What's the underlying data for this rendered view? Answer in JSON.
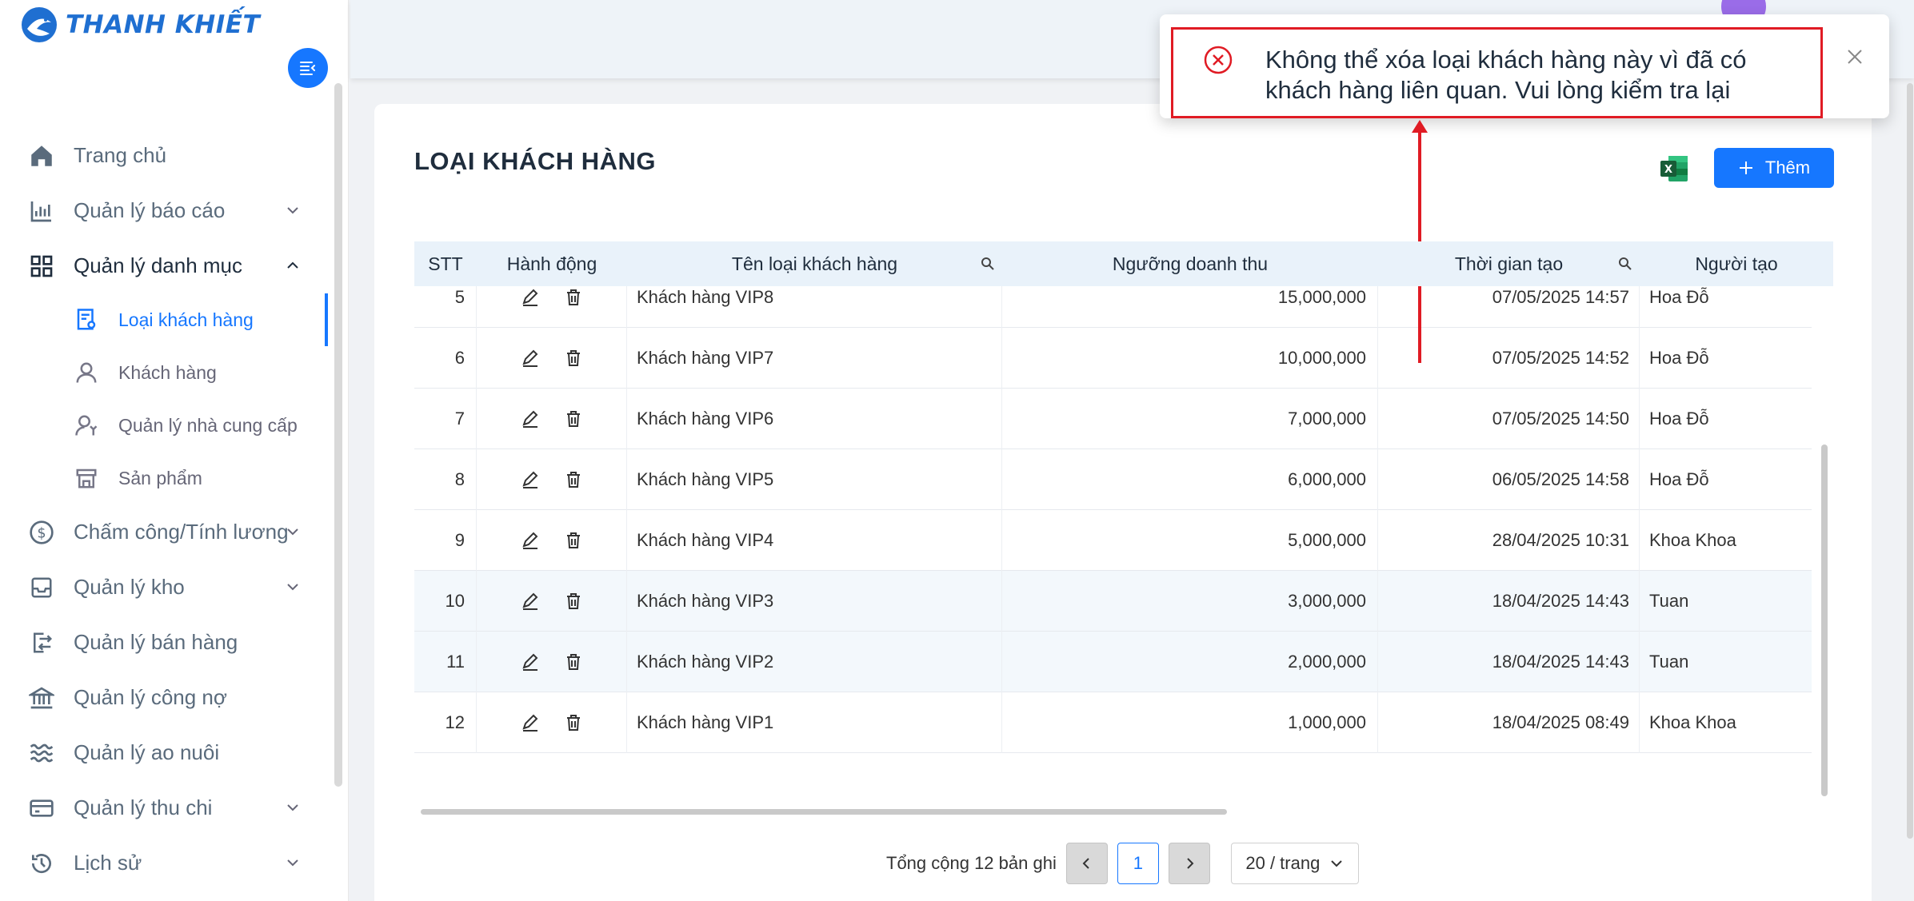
{
  "brand": {
    "name": "THANH KHIẾT"
  },
  "sidebar": {
    "items": [
      {
        "label": "Trang chủ"
      },
      {
        "label": "Quản lý báo cáo"
      },
      {
        "label": "Quản lý danh mục"
      },
      {
        "label": "Chấm công/Tính lương"
      },
      {
        "label": "Quản lý kho"
      },
      {
        "label": "Quản lý bán hàng"
      },
      {
        "label": "Quản lý công nợ"
      },
      {
        "label": "Quản lý ao nuôi"
      },
      {
        "label": "Quản lý thu chi"
      },
      {
        "label": "Lịch sử"
      }
    ],
    "sub_items": [
      {
        "label": "Loại khách hàng"
      },
      {
        "label": "Khách hàng"
      },
      {
        "label": "Quản lý nhà cung cấp"
      },
      {
        "label": "Sản phẩm"
      }
    ]
  },
  "page": {
    "title": "LOẠI KHÁCH HÀNG",
    "add_label": "Thêm"
  },
  "table": {
    "columns": [
      "STT",
      "Hành động",
      "Tên loại khách hàng",
      "Ngưỡng doanh thu",
      "Thời gian tạo",
      "Người tạo"
    ],
    "rows": [
      {
        "stt": "5",
        "name": "Khách hàng VIP8",
        "threshold": "15,000,000",
        "created": "07/05/2025 14:57",
        "creator": "Hoa Đỗ"
      },
      {
        "stt": "6",
        "name": "Khách hàng VIP7",
        "threshold": "10,000,000",
        "created": "07/05/2025 14:52",
        "creator": "Hoa Đỗ"
      },
      {
        "stt": "7",
        "name": "Khách hàng VIP6",
        "threshold": "7,000,000",
        "created": "07/05/2025 14:50",
        "creator": "Hoa Đỗ"
      },
      {
        "stt": "8",
        "name": "Khách hàng VIP5",
        "threshold": "6,000,000",
        "created": "06/05/2025 14:58",
        "creator": "Hoa Đỗ"
      },
      {
        "stt": "9",
        "name": "Khách hàng VIP4",
        "threshold": "5,000,000",
        "created": "28/04/2025 10:31",
        "creator": "Khoa Khoa"
      },
      {
        "stt": "10",
        "name": "Khách hàng VIP3",
        "threshold": "3,000,000",
        "created": "18/04/2025 14:43",
        "creator": "Tuan"
      },
      {
        "stt": "11",
        "name": "Khách hàng VIP2",
        "threshold": "2,000,000",
        "created": "18/04/2025 14:43",
        "creator": "Tuan"
      },
      {
        "stt": "12",
        "name": "Khách hàng VIP1",
        "threshold": "1,000,000",
        "created": "18/04/2025 08:49",
        "creator": "Khoa Khoa"
      }
    ]
  },
  "pagination": {
    "total_text": "Tổng cộng 12 bản ghi",
    "current_page": "1",
    "page_size": "20 / trang"
  },
  "toast": {
    "message": "Không thể xóa loại khách hàng này vì đã có khách hàng liên quan. Vui lòng kiểm tra lại"
  },
  "colors": {
    "primary": "#1677ff",
    "error": "#e01b24",
    "header_bg": "#e9f2fa"
  }
}
